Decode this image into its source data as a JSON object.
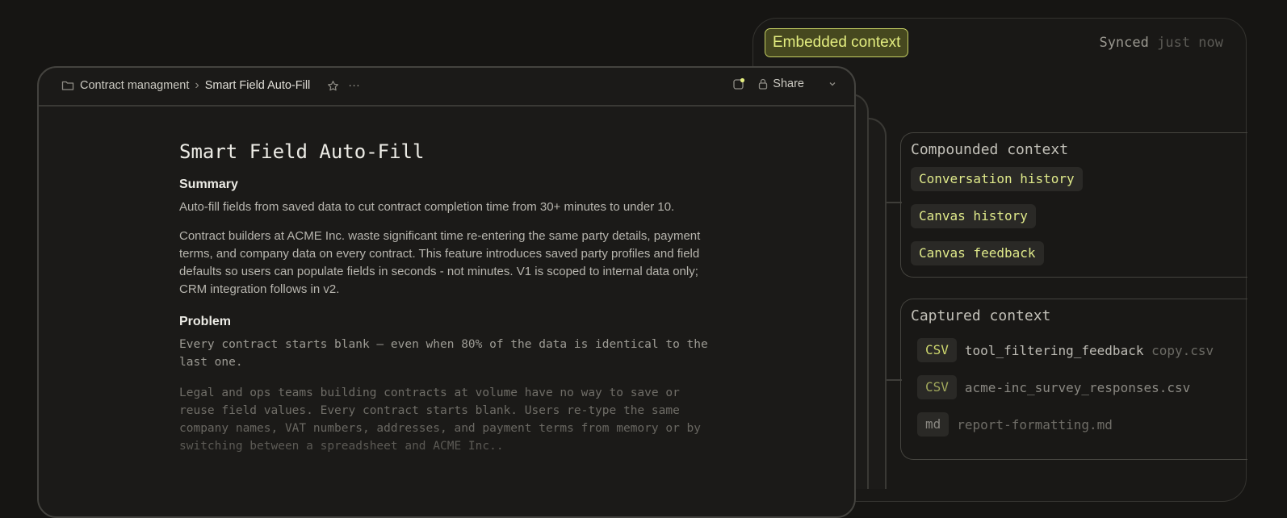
{
  "context_panel": {
    "badge": "Embedded context",
    "synced_prefix": "Synced ",
    "synced_suffix": "just now",
    "compounded": {
      "title": "Compounded context",
      "chips": [
        "Conversation history",
        "Canvas history",
        "Canvas feedback"
      ]
    },
    "captured": {
      "title": "Captured context",
      "files": [
        {
          "tag": "CSV",
          "name": "tool_filtering_feedback",
          "suffix": " copy.csv"
        },
        {
          "tag": "CSV",
          "name": "acme-inc_survey_responses.csv",
          "suffix": ""
        },
        {
          "tag": "md",
          "name": "report-formatting.md",
          "suffix": ""
        }
      ]
    }
  },
  "doc_header": {
    "folder": "Contract managment",
    "separator": "›",
    "page": "Smart Field Auto-Fill",
    "share_label": "Share",
    "more": "···"
  },
  "doc": {
    "title": "Smart Field Auto-Fill",
    "summary_heading": "Summary",
    "summary_p1": "Auto-fill fields from saved data to cut contract completion time from 30+ minutes to under 10.",
    "summary_p2": "Contract builders at ACME Inc. waste significant time re-entering the same party details, payment terms, and company data on every contract. This feature introduces saved party profiles and field defaults so users can populate fields in seconds - not minutes. V1 is scoped to internal data only; CRM integration follows in v2.",
    "problem_heading": "Problem",
    "problem_p1": "Every contract starts blank — even when 80% of the data is identical to the last one.",
    "problem_p2": "Legal and ops teams building contracts at volume have no way to save or reuse field values. Every contract starts blank. Users re-type the same company names, VAT numbers, addresses, and payment terms from memory or by switching between a spreadsheet and ACME Inc.."
  },
  "colors": {
    "accent": "#e4ee80",
    "background": "#161513"
  }
}
